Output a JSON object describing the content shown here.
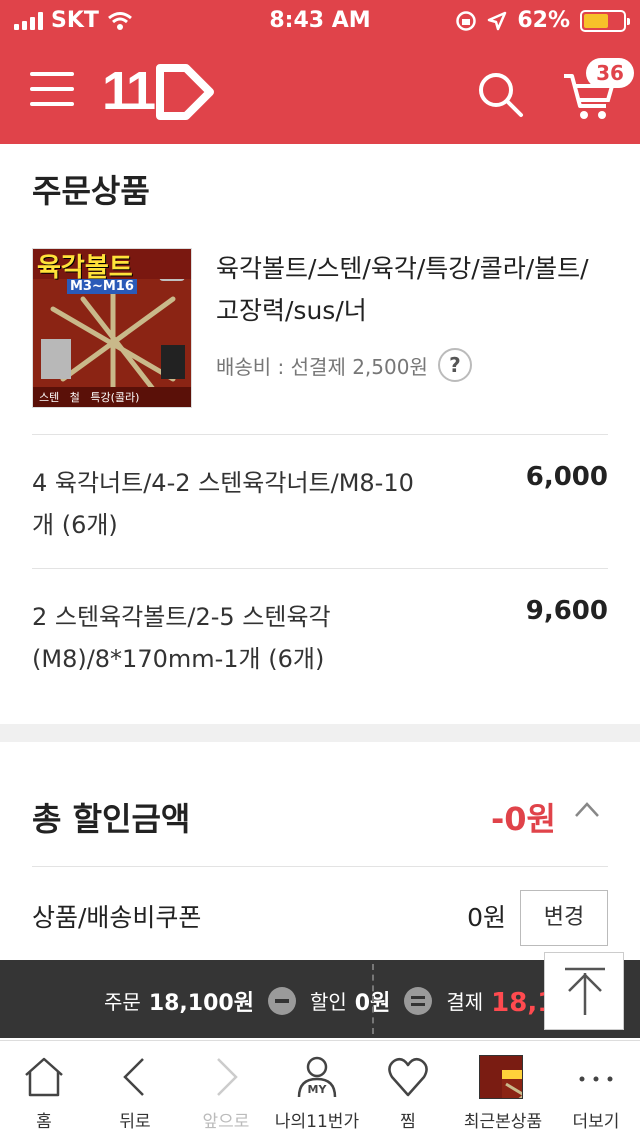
{
  "status_bar": {
    "carrier": "SKT",
    "time": "8:43 AM",
    "battery": "62%",
    "battery_level": 0.62
  },
  "header": {
    "logo_text": "11",
    "cart_count": "36"
  },
  "order": {
    "section_title": "주문상품",
    "product": {
      "thumb_text": "육각볼트",
      "thumb_sub": "M3~M16",
      "thumb_bottom": "스텐   철   특강(콜라)",
      "name": "육각볼트/스텐/육각/특강/콜라/볼트/고장력/sus/너",
      "shipping": "배송비 : 선결제 2,500원",
      "help": "?"
    },
    "options": [
      {
        "name": "4 육각너트/4-2 스텐육각너트/M8-10개 (6개)",
        "price": "6,000"
      },
      {
        "name": "2 스텐육각볼트/2-5 스텐육각(M8)/8*170mm-1개 (6개)",
        "price": "9,600"
      }
    ]
  },
  "discount": {
    "title": "총 할인금액",
    "value": "-0원",
    "coupon_label": "상품/배송비쿠폰",
    "coupon_value": "0원",
    "change_label": "변경"
  },
  "summary": {
    "order_label": "주문",
    "order_value": "18,100원",
    "discount_label": "할인",
    "discount_value": "0원",
    "pay_label": "결제",
    "pay_value": "18,100원"
  },
  "bottom_nav": {
    "home": "홈",
    "back": "뒤로",
    "forward": "앞으로",
    "my": "나의11번가",
    "my_badge": "MY",
    "wish": "찜",
    "recent": "최근본상품",
    "more": "더보기"
  },
  "colors": {
    "brand": "#e0434a",
    "summary_bg": "#353535"
  }
}
